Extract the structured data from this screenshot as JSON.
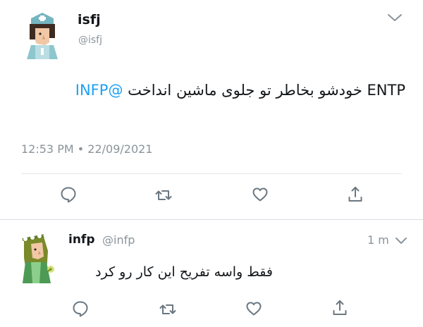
{
  "tweet": {
    "author_name": "isfj",
    "author_handle": "@isfj",
    "text_latin": "ENTP",
    "text_persian": "خودشو بخاطر تو جلوی ماشین انداخت",
    "mention": "@INFP",
    "timestamp": "12:53 PM • 22/09/2021",
    "avatar_icon": "nurse-avatar-icon",
    "actions": [
      "reply-icon",
      "retweet-icon",
      "like-icon",
      "share-icon"
    ]
  },
  "reply": {
    "author_name": "infp",
    "author_handle": "@infp",
    "time": "1 m",
    "text": "فقط واسه تفریح این کار رو کرد",
    "avatar_icon": "flower-crown-avatar-icon",
    "actions": [
      "reply-icon",
      "retweet-icon",
      "like-icon",
      "share-icon"
    ]
  },
  "colors": {
    "text": "#14171a",
    "secondary": "#8a949b",
    "mention": "#1da1f2",
    "divider": "#e2e6ea"
  }
}
